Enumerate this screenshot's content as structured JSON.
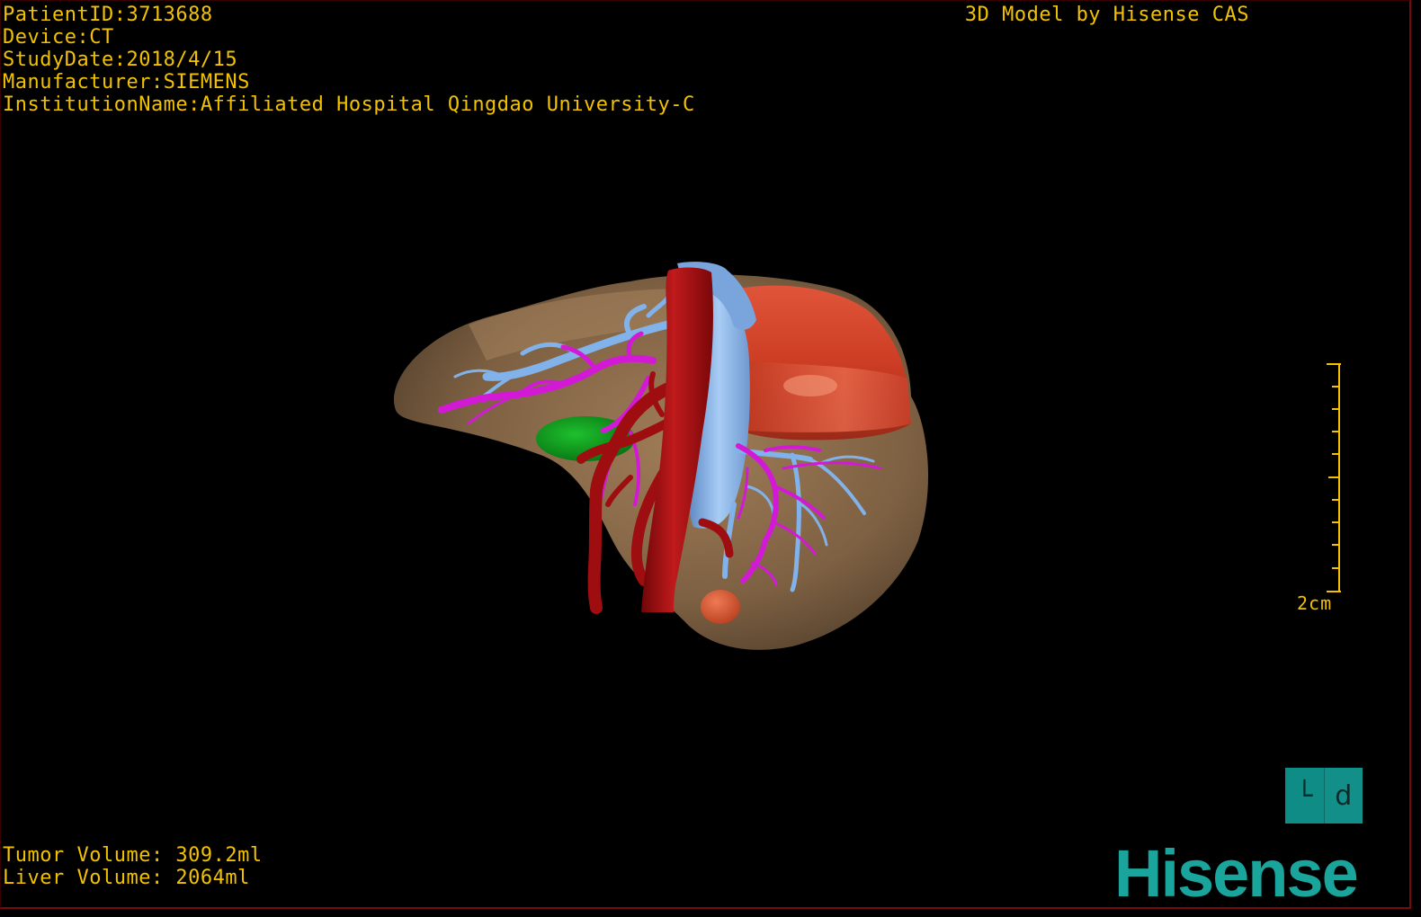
{
  "patient_info": {
    "patient_id": "PatientID:3713688",
    "device": "Device:CT",
    "study_date": "StudyDate:2018/4/15",
    "manufacturer": "Manufacturer:SIEMENS",
    "institution": "InstitutionName:Affiliated Hospital Qingdao University-C"
  },
  "credit": "3D Model by Hisense CAS",
  "volumes": {
    "tumor": "Tumor Volume: 309.2ml",
    "liver": "Liver Volume: 2064ml"
  },
  "scale": {
    "label": "2cm"
  },
  "orientation_cube": {
    "left_face": "└",
    "right_face": "d"
  },
  "brand": {
    "logo_text": "Hisense",
    "color": "#1aa59c"
  },
  "colors": {
    "overlay_text": "#f2c200",
    "liver": "#8a6a48",
    "tumor": "#d8442a",
    "artery": "#a50f12",
    "portal_vein": "#8fb8ea",
    "hepatic_vein": "#d01ad8",
    "gallbladder": "#0a9a1a"
  }
}
